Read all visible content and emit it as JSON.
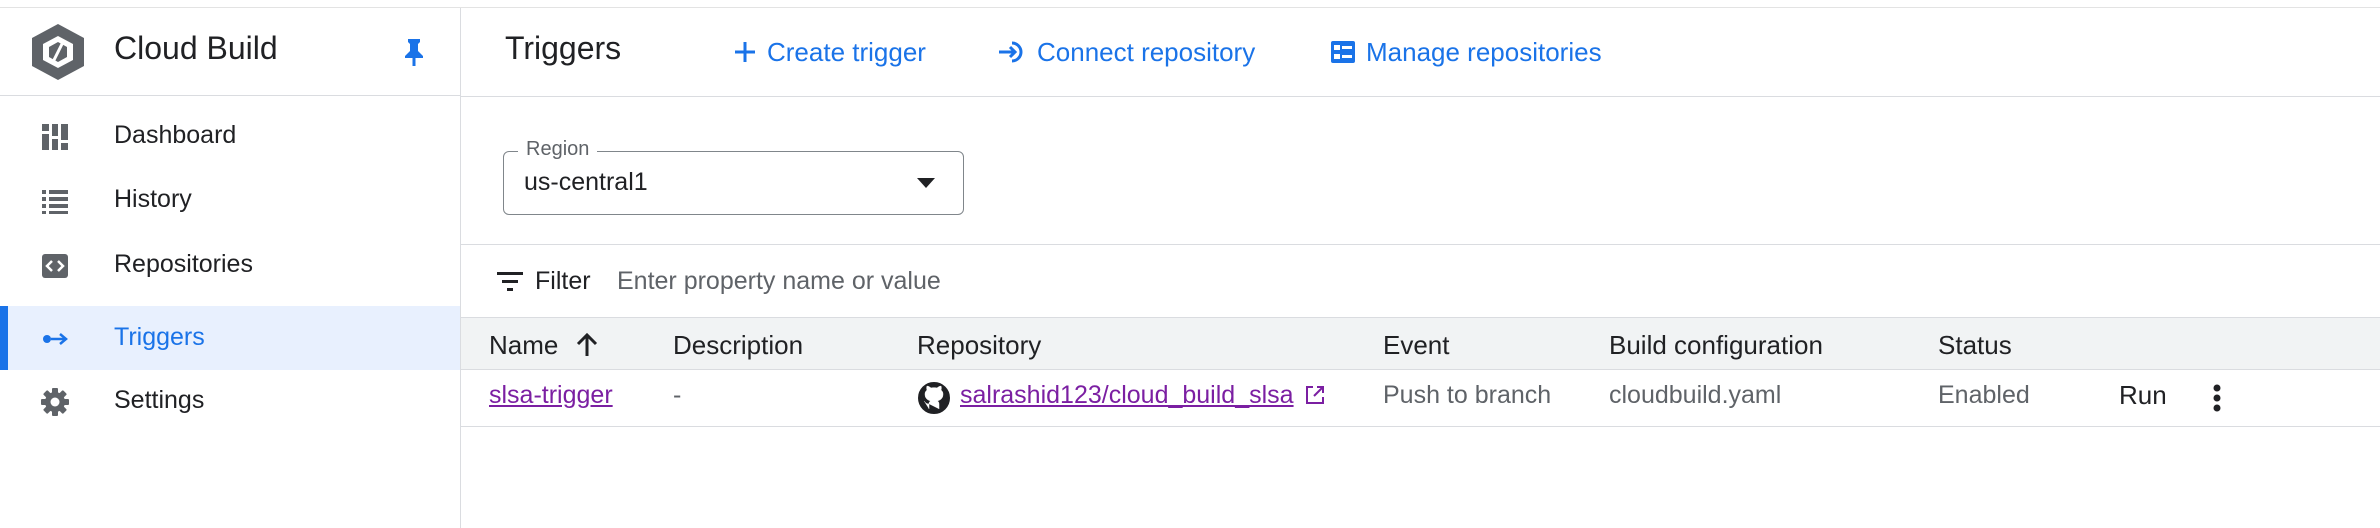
{
  "sidebar": {
    "brand": {
      "title": "Cloud Build",
      "logo_icon": "cloud-build-logo",
      "pin_icon": "pin-icon"
    },
    "items": [
      {
        "label": "Dashboard",
        "icon": "dashboard-icon",
        "active": false
      },
      {
        "label": "History",
        "icon": "list-icon",
        "active": false
      },
      {
        "label": "Repositories",
        "icon": "code-icon",
        "active": false
      },
      {
        "label": "Triggers",
        "icon": "trigger-icon",
        "active": true
      },
      {
        "label": "Settings",
        "icon": "gear-icon",
        "active": false
      }
    ]
  },
  "header": {
    "title": "Triggers",
    "actions": [
      {
        "label": "Create trigger",
        "icon": "plus-icon"
      },
      {
        "label": "Connect repository",
        "icon": "connect-icon"
      },
      {
        "label": "Manage repositories",
        "icon": "manage-icon"
      }
    ]
  },
  "region": {
    "label": "Region",
    "value": "us-central1"
  },
  "filter": {
    "label": "Filter",
    "placeholder": "Enter property name or value"
  },
  "table": {
    "columns": [
      "Name",
      "Description",
      "Repository",
      "Event",
      "Build configuration",
      "Status"
    ],
    "sort": {
      "column": "Name",
      "direction": "ascending"
    },
    "rows": [
      {
        "name": "slsa-trigger",
        "description": "-",
        "repository": "salrashid123/cloud_build_slsa",
        "event": "Push to branch",
        "build_config": "cloudbuild.yaml",
        "status": "Enabled",
        "run_label": "Run"
      }
    ]
  },
  "colors": {
    "accent": "#1a73e8",
    "active_bg": "#e8f0fe",
    "link_visited": "#7b1fa2",
    "table_header_bg": "#f1f3f4",
    "border": "#dadce0"
  }
}
